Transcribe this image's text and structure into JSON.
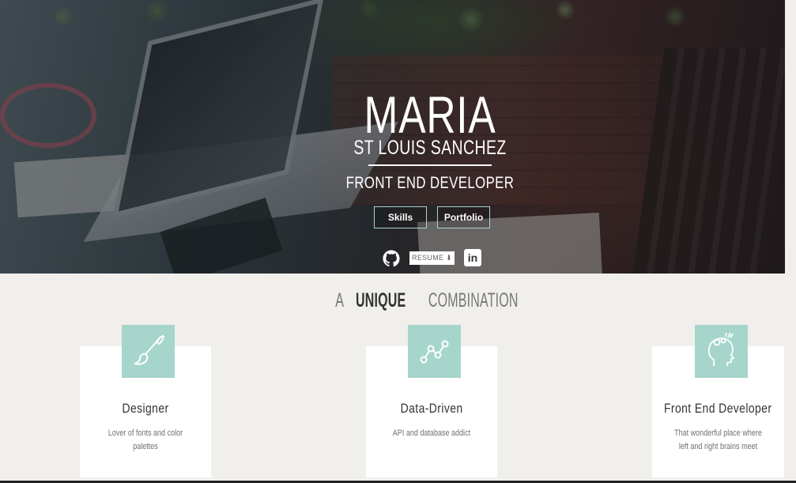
{
  "hero": {
    "first_name": "MARIA",
    "last_name": "ST LOUIS SANCHEZ",
    "role": "FRONT END DEVELOPER",
    "buttons": {
      "skills": "Skills",
      "portfolio": "Portfolio"
    },
    "social": {
      "resume_label": "RESUME",
      "github_icon": "github-icon",
      "linkedin_icon": "linkedin-icon",
      "linkedin_text": "in"
    }
  },
  "section": {
    "title_pre": "A",
    "title_emphasis": "UNIQUE",
    "title_post": "COMBINATION",
    "cards": [
      {
        "icon": "paintbrush-icon",
        "title": "Designer",
        "description": "Lover of fonts and color palettes"
      },
      {
        "icon": "data-chart-icon",
        "title": "Data-Driven",
        "description": "API and database addict"
      },
      {
        "icon": "head-gears-icon",
        "title": "Front End Developer",
        "description": "That wonderful place where left and right brains meet"
      }
    ]
  },
  "colors": {
    "accent": "#a6d5cc",
    "background": "#f1efeb"
  }
}
